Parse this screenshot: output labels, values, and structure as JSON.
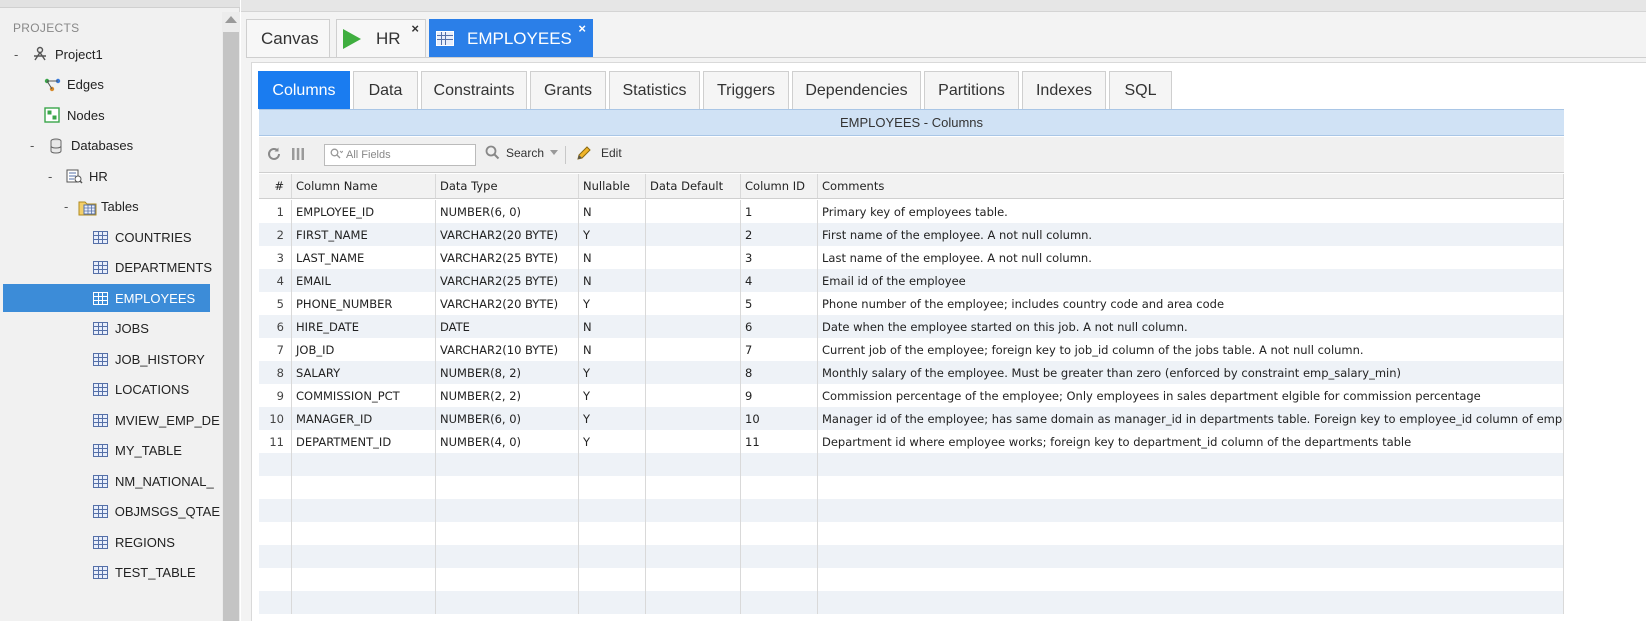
{
  "sidebar": {
    "header": "PROJECTS",
    "nodes": [
      {
        "label": "Project1",
        "toggle": "-",
        "icon": "project-icon"
      },
      {
        "label": "Edges",
        "toggle": "",
        "icon": "edges-icon"
      },
      {
        "label": "Nodes",
        "toggle": "",
        "icon": "nodes-icon"
      },
      {
        "label": "Databases",
        "toggle": "-",
        "icon": "database-icon"
      },
      {
        "label": "HR",
        "toggle": "-",
        "icon": "schema-icon"
      },
      {
        "label": "Tables",
        "toggle": "-",
        "icon": "tables-folder-icon"
      },
      {
        "label": "COUNTRIES",
        "toggle": "",
        "icon": "table-icon"
      },
      {
        "label": "DEPARTMENTS",
        "toggle": "",
        "icon": "table-icon"
      },
      {
        "label": "EMPLOYEES",
        "toggle": "",
        "icon": "table-icon"
      },
      {
        "label": "JOBS",
        "toggle": "",
        "icon": "table-icon"
      },
      {
        "label": "JOB_HISTORY",
        "toggle": "",
        "icon": "table-icon"
      },
      {
        "label": "LOCATIONS",
        "toggle": "",
        "icon": "table-icon"
      },
      {
        "label": "MVIEW_EMP_DE",
        "toggle": "",
        "icon": "table-icon"
      },
      {
        "label": "MY_TABLE",
        "toggle": "",
        "icon": "table-icon"
      },
      {
        "label": "NM_NATIONAL_",
        "toggle": "",
        "icon": "table-icon"
      },
      {
        "label": "OBJMSGS_QTAE",
        "toggle": "",
        "icon": "table-icon"
      },
      {
        "label": "REGIONS",
        "toggle": "",
        "icon": "table-icon"
      },
      {
        "label": "TEST_TABLE",
        "toggle": "",
        "icon": "table-icon"
      }
    ],
    "selected": "EMPLOYEES"
  },
  "editor_tabs": [
    {
      "label": "Canvas",
      "icon": "",
      "closable": false,
      "active": false
    },
    {
      "label": "HR",
      "icon": "play-icon",
      "closable": true,
      "active": false
    },
    {
      "label": "EMPLOYEES",
      "icon": "table-icon",
      "closable": true,
      "active": true
    }
  ],
  "close_glyph": "×",
  "sub_tabs": [
    "Columns",
    "Data",
    "Constraints",
    "Grants",
    "Statistics",
    "Triggers",
    "Dependencies",
    "Partitions",
    "Indexes",
    "SQL"
  ],
  "active_sub_tab": "Columns",
  "panel_title": "EMPLOYEES - Columns",
  "toolbar": {
    "search_placeholder": "All Fields",
    "search_label": "Search",
    "edit_label": "Edit"
  },
  "grid": {
    "headers": [
      "#",
      "Column Name",
      "Data Type",
      "Nullable",
      "Data Default",
      "Column ID",
      "Comments"
    ],
    "rows": [
      [
        "1",
        "EMPLOYEE_ID",
        "NUMBER(6, 0)",
        "N",
        "",
        "1",
        "Primary key of employees table."
      ],
      [
        "2",
        "FIRST_NAME",
        "VARCHAR2(20 BYTE)",
        "Y",
        "",
        "2",
        "First name of the employee. A not null column."
      ],
      [
        "3",
        "LAST_NAME",
        "VARCHAR2(25 BYTE)",
        "N",
        "",
        "3",
        "Last name of the employee. A not null column."
      ],
      [
        "4",
        "EMAIL",
        "VARCHAR2(25 BYTE)",
        "N",
        "",
        "4",
        "Email id of the employee"
      ],
      [
        "5",
        "PHONE_NUMBER",
        "VARCHAR2(20 BYTE)",
        "Y",
        "",
        "5",
        "Phone number of the employee; includes country code and area code"
      ],
      [
        "6",
        "HIRE_DATE",
        "DATE",
        "N",
        "",
        "6",
        "Date when the employee started on this job. A not null column."
      ],
      [
        "7",
        "JOB_ID",
        "VARCHAR2(10 BYTE)",
        "N",
        "",
        "7",
        "Current job of the employee; foreign key to job_id column of the jobs table. A not null column."
      ],
      [
        "8",
        "SALARY",
        "NUMBER(8, 2)",
        "Y",
        "",
        "8",
        "Monthly salary of the employee. Must be greater than zero (enforced by constraint emp_salary_min)"
      ],
      [
        "9",
        "COMMISSION_PCT",
        "NUMBER(2, 2)",
        "Y",
        "",
        "9",
        "Commission percentage of the employee; Only employees in sales department elgible for commission percentage"
      ],
      [
        "10",
        "MANAGER_ID",
        "NUMBER(6, 0)",
        "Y",
        "",
        "10",
        "Manager id of the employee; has same domain as manager_id in departments table. Foreign key to employee_id column of employees ta..."
      ],
      [
        "11",
        "DEPARTMENT_ID",
        "NUMBER(4, 0)",
        "Y",
        "",
        "11",
        "Department id where employee works; foreign key to department_id column of the departments table"
      ]
    ]
  },
  "colors": {
    "active_tab": "#1a7cf0",
    "selection": "#3c8cd8",
    "panel_header": "#d0e2f5"
  }
}
